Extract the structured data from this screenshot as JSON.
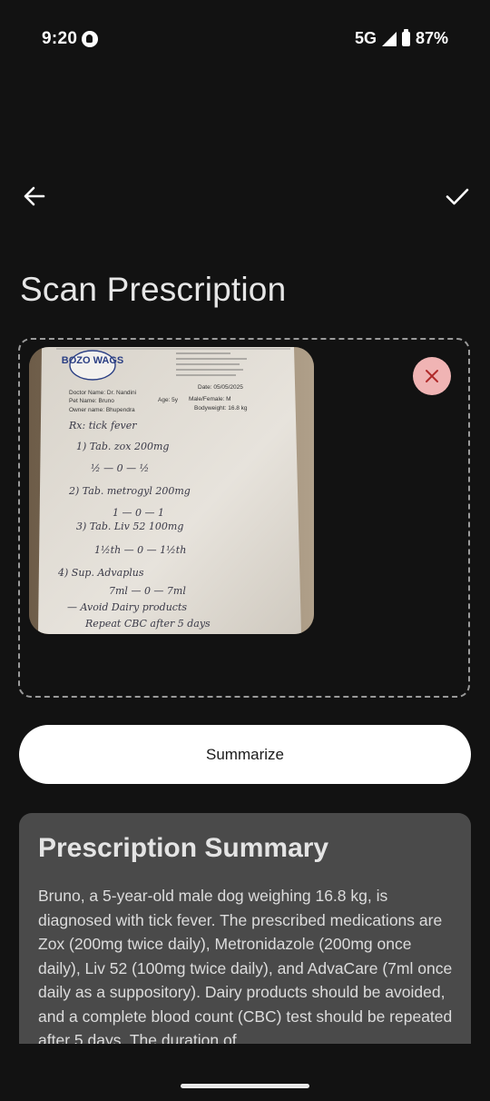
{
  "status_bar": {
    "time": "9:20",
    "network": "5G",
    "battery": "87%",
    "icons": [
      "whatsapp-call-icon",
      "signal-icon",
      "battery-icon"
    ]
  },
  "toolbar": {
    "back_icon": "arrow-left-icon",
    "confirm_icon": "check-icon"
  },
  "page": {
    "title": "Scan Prescription"
  },
  "image": {
    "remove_icon": "close-icon",
    "handwritten_lines": [
      "Rx: tick fever",
      "1) Tab. zox 200mg",
      "½ — 0 — ½",
      "2) Tab. metrogyl 200mg",
      "1 — 0 — 1",
      "3) Tab. Liv 52 100mg",
      "1½th — 0 — 1½th",
      "4) Sup. Advaplus",
      "7ml — 0 — 7ml",
      "— Avoid Dairy products",
      "Repeat CBC after 5 days"
    ],
    "letterhead": {
      "logo_text": "BOZO WAGS",
      "fields": [
        "Doctor Name: Dr. Nandini",
        "Date: 05/05/2025",
        "Pet Name: Bruno",
        "Age: 5y",
        "Male/Female: M",
        "Owner name: Bhupendra",
        "Bodyweight: 16.8 kg"
      ]
    }
  },
  "actions": {
    "summarize_label": "Summarize"
  },
  "summary": {
    "title": "Prescription Summary",
    "text": "Bruno, a 5-year-old male dog weighing 16.8 kg, is diagnosed with tick fever.  The prescribed medications are Zox (200mg twice daily), Metronidazole (200mg once daily), Liv 52 (100mg twice daily), and AdvaCare (7ml once daily as a suppository). Dairy products should be avoided, and a complete blood count (CBC) test should be repeated after 5 days. The duration of"
  },
  "colors": {
    "background": "#121212",
    "card": "#4a4a4a",
    "remove_button": "#f0b4b4",
    "primary_button": "#ffffff"
  }
}
